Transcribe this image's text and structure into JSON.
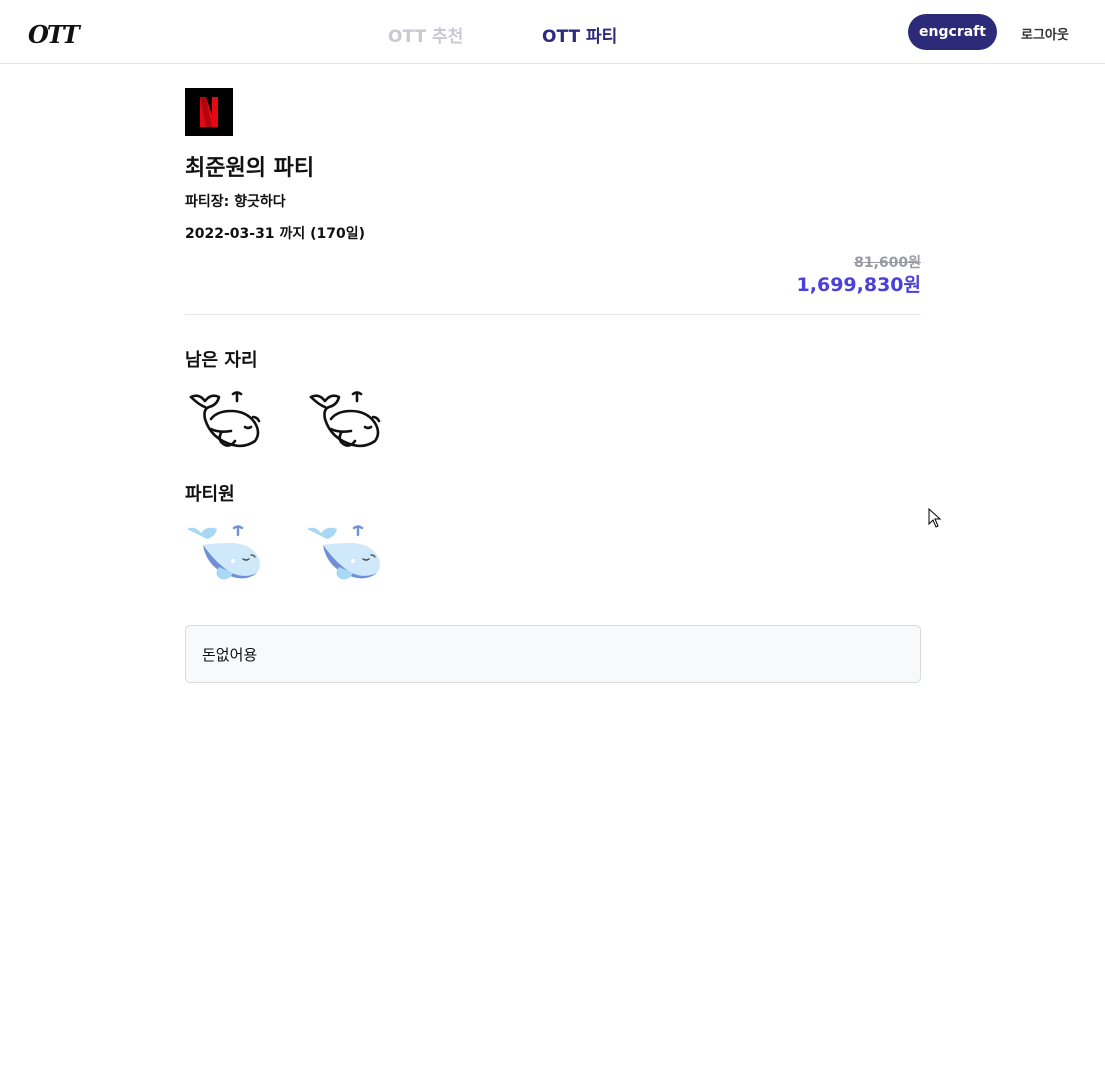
{
  "header": {
    "logo_text": "OTT",
    "nav": {
      "recommend_label": "OTT 추천",
      "party_label": "OTT 파티"
    },
    "user_name": "engcraft",
    "logout_label": "로그아웃"
  },
  "party": {
    "service_logo_letter": "N",
    "title": "최준원의 파티",
    "leader_label": "파티장:",
    "leader_name": "향긋하다",
    "end_date": "2022-03-31",
    "until_label": "까지",
    "days_left": "(170일)",
    "original_price": "81,600원",
    "final_price": "1,699,830원"
  },
  "sections": {
    "seats_title": "남은 자리",
    "members_title": "파티원"
  },
  "remaining_seats": 2,
  "members_count": 2,
  "comment": "돈없어용",
  "colors": {
    "brand_dark": "#2e2a7a",
    "nav_inactive": "#c9c9d1",
    "price_accent": "#4b40d8",
    "netflix_red": "#e50914",
    "whale_light": "#a9d8f5",
    "whale_dark": "#6f8fd6"
  }
}
